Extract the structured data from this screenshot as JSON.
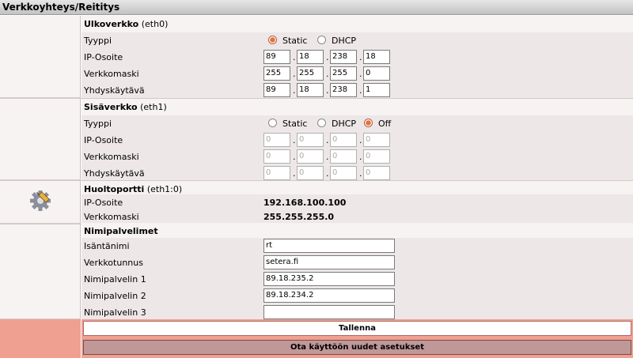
{
  "title": "Verkkoyhteys/Reititys",
  "wan": {
    "header": "Ulkoverkko",
    "iface": "(eth0)",
    "type_label": "Tyyppi",
    "options": [
      "Static",
      "DHCP"
    ],
    "selected": "Static",
    "ip_label": "IP-Osoite",
    "ip": [
      "89",
      "18",
      "238",
      "18"
    ],
    "mask_label": "Verkkomaski",
    "mask": [
      "255",
      "255",
      "255",
      "0"
    ],
    "gw_label": "Yhdyskäytävä",
    "gw": [
      "89",
      "18",
      "238",
      "1"
    ]
  },
  "lan": {
    "header": "Sisäverkko",
    "iface": "(eth1)",
    "type_label": "Tyyppi",
    "options": [
      "Static",
      "DHCP",
      "Off"
    ],
    "selected": "Off",
    "ip_label": "IP-Osoite",
    "ip": [
      "0",
      "0",
      "0",
      "0"
    ],
    "mask_label": "Verkkomaski",
    "mask": [
      "0",
      "0",
      "0",
      "0"
    ],
    "gw_label": "Yhdyskäytävä",
    "gw": [
      "0",
      "0",
      "0",
      "0"
    ]
  },
  "service": {
    "header": "Huoltoportti",
    "iface": "(eth1:0)",
    "ip_label": "IP-Osoite",
    "ip": "192.168.100.100",
    "mask_label": "Verkkomaski",
    "mask": "255.255.255.0",
    "icon": "gear-icon"
  },
  "dns": {
    "header": "Nimipalvelimet",
    "hostname_label": "Isäntänimi",
    "hostname": "rt",
    "domain_label": "Verkkotunnus",
    "domain": "setera.fi",
    "ns1_label": "Nimipalvelin 1",
    "ns1": "89.18.235.2",
    "ns2_label": "Nimipalvelin 2",
    "ns2": "89.18.234.2",
    "ns3_label": "Nimipalvelin 3",
    "ns3": ""
  },
  "buttons": {
    "save": "Tallenna",
    "apply": "Ota käyttöön uudet asetukset"
  },
  "colors": {
    "accent": "#e8703a",
    "button_row": "#f0a090",
    "apply_button": "#c09898"
  }
}
